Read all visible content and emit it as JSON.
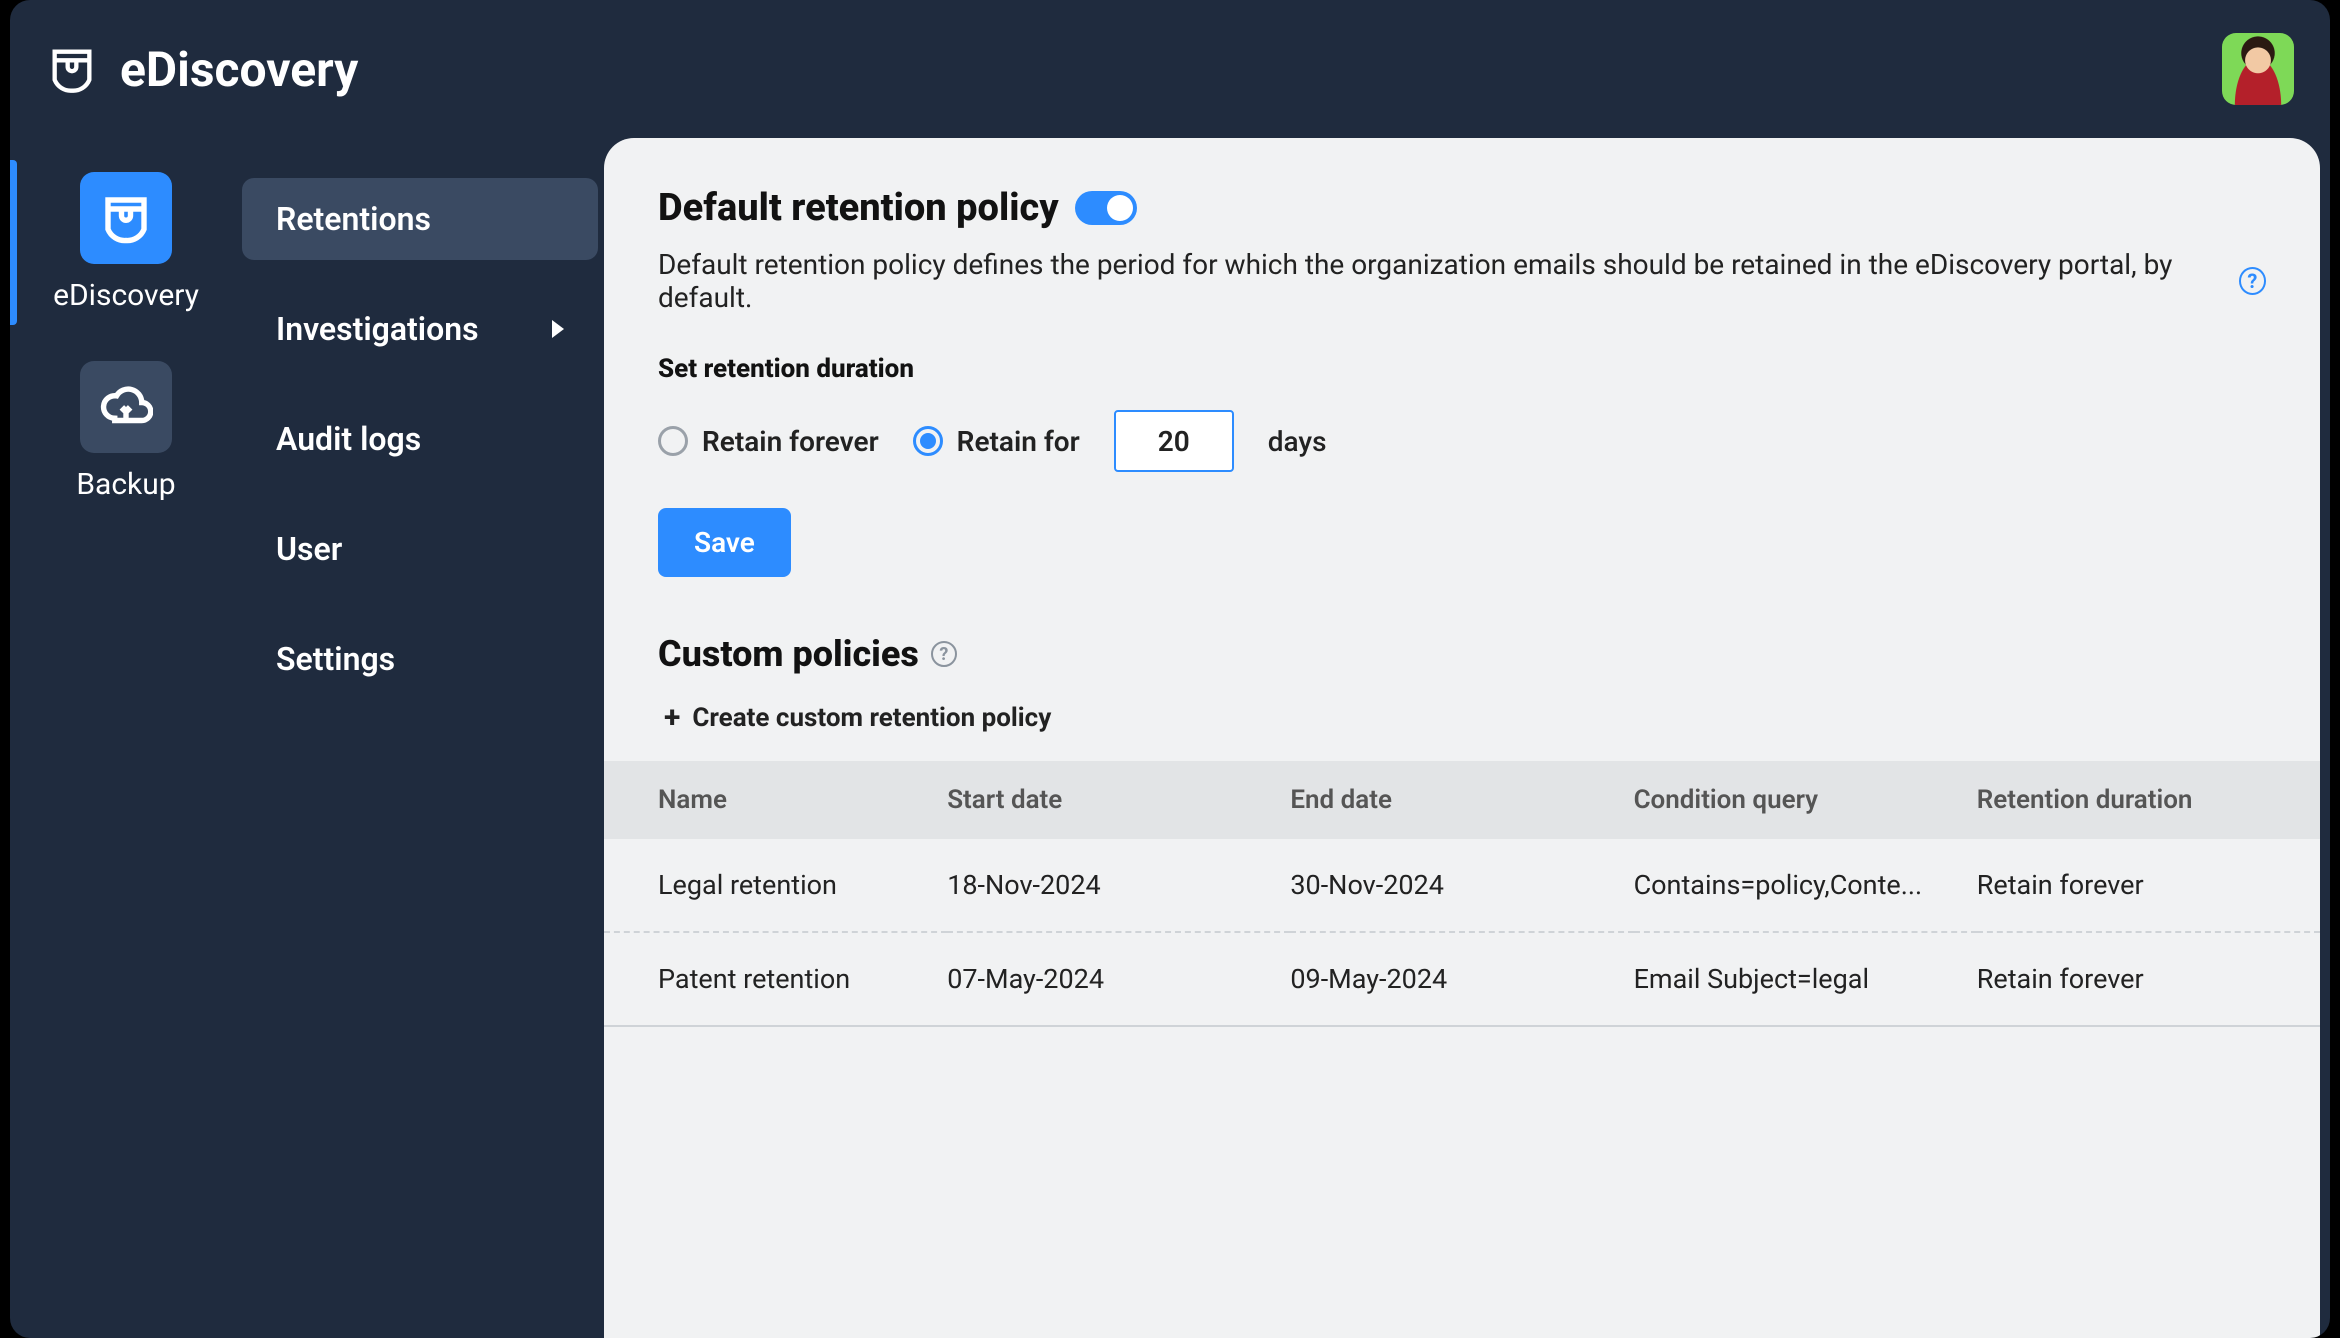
{
  "header": {
    "title": "eDiscovery"
  },
  "rail": {
    "items": [
      {
        "label": "eDiscovery",
        "active": true
      },
      {
        "label": "Backup",
        "active": false
      }
    ]
  },
  "secnav": {
    "items": [
      {
        "label": "Retentions",
        "active": true,
        "has_submenu": false
      },
      {
        "label": "Investigations",
        "active": false,
        "has_submenu": true
      },
      {
        "label": "Audit logs",
        "active": false,
        "has_submenu": false
      },
      {
        "label": "User",
        "active": false,
        "has_submenu": false
      },
      {
        "label": "Settings",
        "active": false,
        "has_submenu": false
      }
    ]
  },
  "main": {
    "title": "Default retention policy",
    "toggle_on": true,
    "description": "Default retention policy defines the period for which the organization emails should be retained in the eDiscovery portal, by default.",
    "duration_section_label": "Set retention duration",
    "radio_forever_label": "Retain forever",
    "radio_for_label": "Retain for",
    "radio_selected": "for",
    "retain_days_value": "20",
    "unit_label": "days",
    "save_label": "Save",
    "custom_title": "Custom policies",
    "create_label": "Create custom retention policy",
    "table": {
      "columns": [
        "Name",
        "Start date",
        "End date",
        "Condition query",
        "Retention duration"
      ],
      "rows": [
        {
          "name": "Legal retention",
          "start": "18-Nov-2024",
          "end": "30-Nov-2024",
          "condition": "Contains=policy,Conte...",
          "retention": "Retain forever"
        },
        {
          "name": "Patent retention",
          "start": "07-May-2024",
          "end": "09-May-2024",
          "condition": "Email Subject=legal",
          "retention": "Retain forever"
        }
      ]
    }
  }
}
